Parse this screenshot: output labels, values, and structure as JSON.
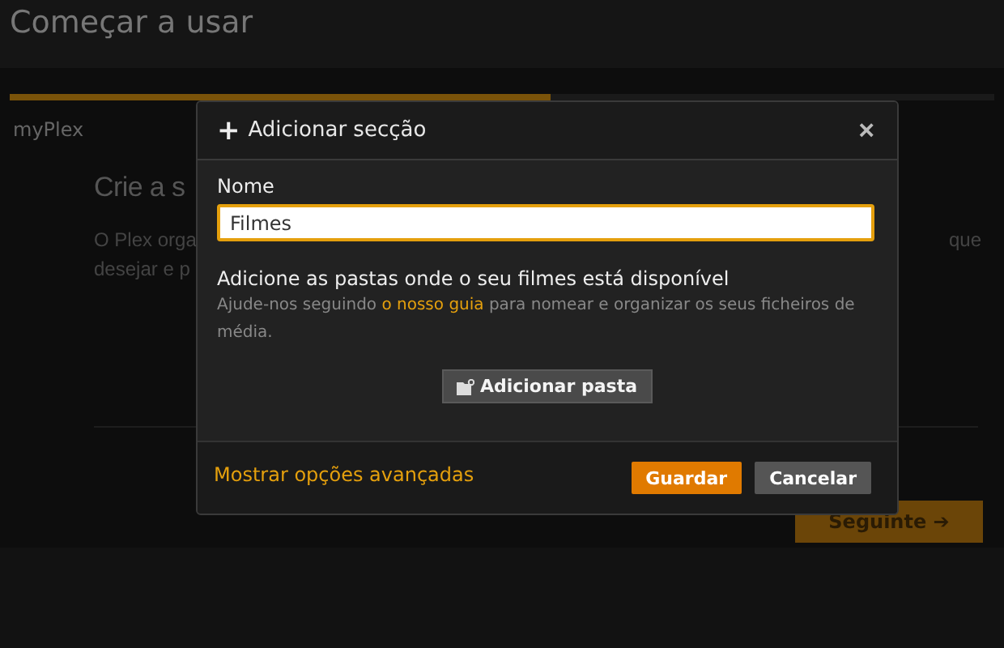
{
  "page": {
    "title": "Começar a usar",
    "progress": {
      "level": 0.55
    },
    "steps": [
      "myPlex"
    ],
    "heading": "Crie a s",
    "paragraph_lines": [
      "O Plex orga",
      "desejar e p"
    ],
    "paragraph_right": "que",
    "next_button": "Seguinte ➔"
  },
  "dialog": {
    "title_icon": "+",
    "title": "Adicionar secção",
    "close": "×",
    "name_label": "Nome",
    "name_field": {
      "value": "Filmes"
    },
    "folders_heading": "Adicione as pastas onde o seu filmes está disponível",
    "help": {
      "before": "Ajude-nos seguindo ",
      "link": "o nosso guia",
      "after": " para nomear e organizar os seus ficheiros de média."
    },
    "add_folder_button": "Adicionar pasta",
    "advanced_link": "Mostrar opções avançadas",
    "buttons": [
      {
        "label": "Guardar",
        "kind": "primary"
      },
      {
        "label": "Cancelar",
        "kind": "secondary"
      }
    ]
  }
}
